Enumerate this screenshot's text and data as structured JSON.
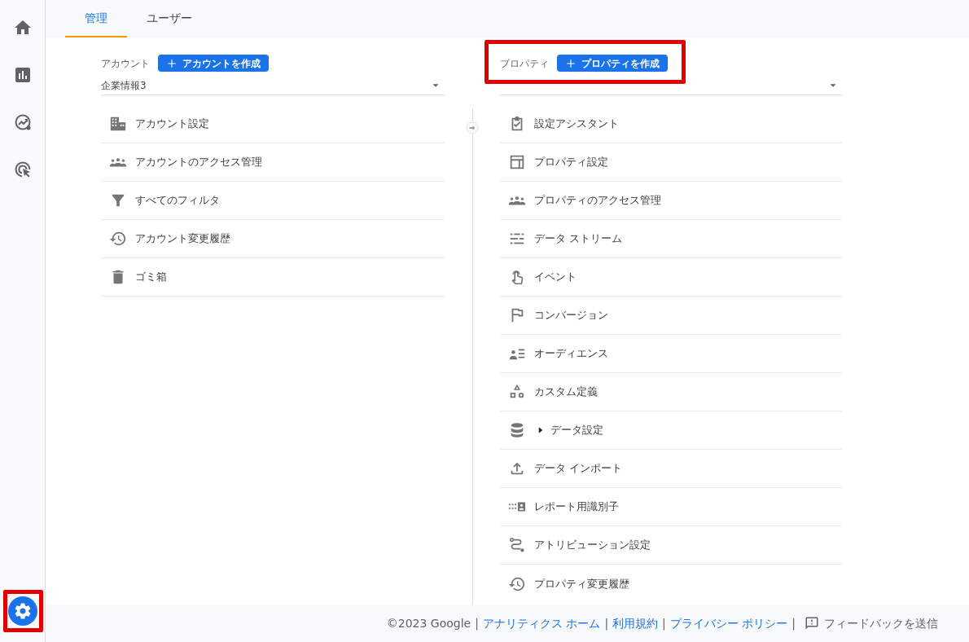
{
  "sidebar": {
    "items": [
      {
        "selected": false
      },
      {
        "selected": false
      },
      {
        "selected": false
      },
      {
        "selected": false
      },
      {
        "selected": true
      }
    ]
  },
  "tabs": [
    {
      "label": "管理",
      "selected": true
    },
    {
      "label": "ユーザー",
      "selected": false
    }
  ],
  "account": {
    "label": "アカウント",
    "create_button": "アカウントを作成",
    "selector_value": "企業情報3",
    "items": [
      {
        "label": "アカウント設定",
        "kind": "link"
      },
      {
        "label": "アカウントのアクセス管理",
        "kind": "link"
      },
      {
        "label": "すべてのフィルタ",
        "kind": "link"
      },
      {
        "label": "アカウント変更履歴",
        "kind": "link"
      },
      {
        "label": "ゴミ箱",
        "kind": "link"
      }
    ]
  },
  "property": {
    "label": "プロパティ",
    "create_button": "プロパティを作成",
    "items": [
      {
        "label": "設定アシスタント",
        "kind": "link"
      },
      {
        "label": "プロパティ設定",
        "kind": "link"
      },
      {
        "label": "プロパティのアクセス管理",
        "kind": "link"
      },
      {
        "label": "データ ストリーム",
        "kind": "link"
      },
      {
        "label": "イベント",
        "kind": "link"
      },
      {
        "label": "コンバージョン",
        "kind": "link"
      },
      {
        "label": "オーディエンス",
        "kind": "link"
      },
      {
        "label": "カスタム定義",
        "kind": "link"
      },
      {
        "label": "データ設定",
        "kind": "expandable",
        "expanded": false
      },
      {
        "label": "データ インポート",
        "kind": "link"
      },
      {
        "label": "レポート用識別子",
        "kind": "link"
      },
      {
        "label": "アトリビューション設定",
        "kind": "link"
      },
      {
        "label": "プロパティ変更履歴",
        "kind": "link"
      }
    ]
  },
  "footer": [
    {
      "kind": "text",
      "text": "©2023 Google"
    },
    {
      "kind": "separator",
      "text": "|"
    },
    {
      "kind": "link",
      "text": "アナリティクス ホーム"
    },
    {
      "kind": "separator",
      "text": "|"
    },
    {
      "kind": "link",
      "text": "利用規約"
    },
    {
      "kind": "separator",
      "text": "|"
    },
    {
      "kind": "link",
      "text": "プライバシー ポリシー"
    },
    {
      "kind": "separator",
      "text": "|"
    },
    {
      "kind": "feedback",
      "text": "フィードバックを送信"
    }
  ]
}
